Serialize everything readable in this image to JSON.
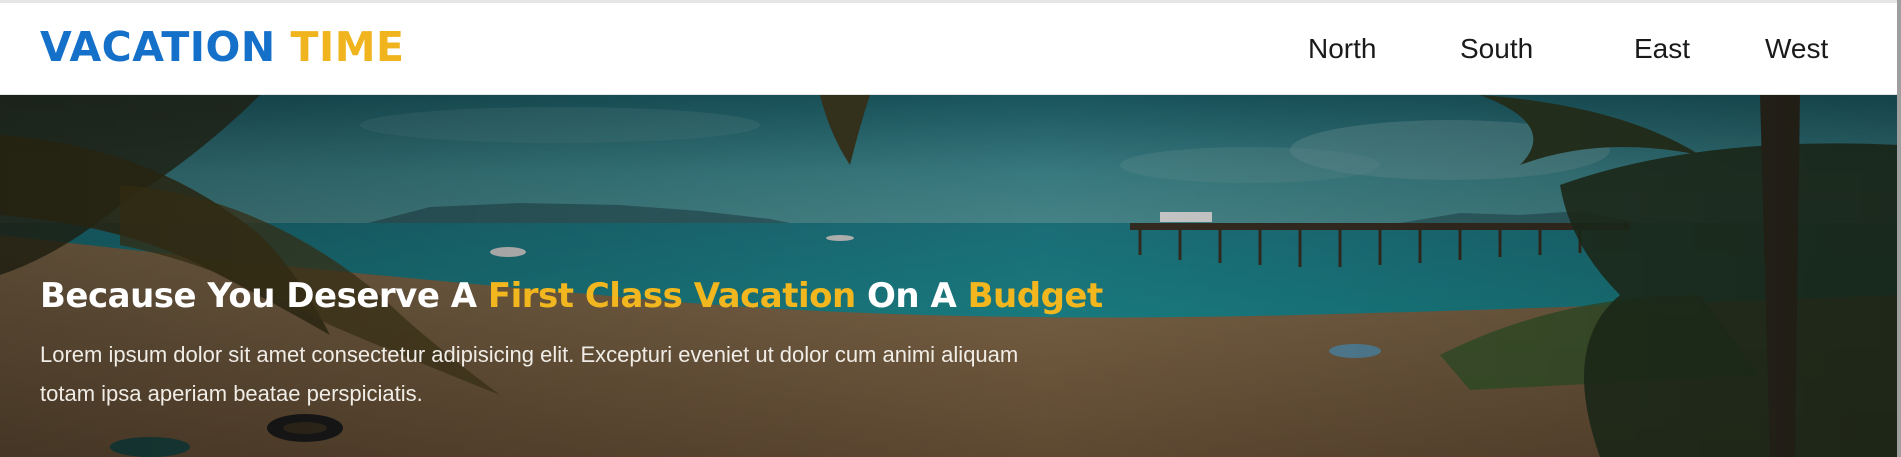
{
  "logo": {
    "part1": "VACATION",
    "part2": "TIME"
  },
  "nav": {
    "items": [
      "North",
      "South",
      "East",
      "West"
    ]
  },
  "hero": {
    "title_parts": [
      "Because You Deserve A ",
      "First Class Vacation",
      " On A ",
      "Budget"
    ],
    "description": "Lorem ipsum dolor sit amet consectetur adipisicing elit. Excepturi eveniet ut dolor cum animi aliquam totam ipsa aperiam beatae perspiciatis."
  },
  "colors": {
    "brand_blue": "#1470c8",
    "accent_yellow": "#f0b41e",
    "nav_text": "#1a1a1a"
  }
}
